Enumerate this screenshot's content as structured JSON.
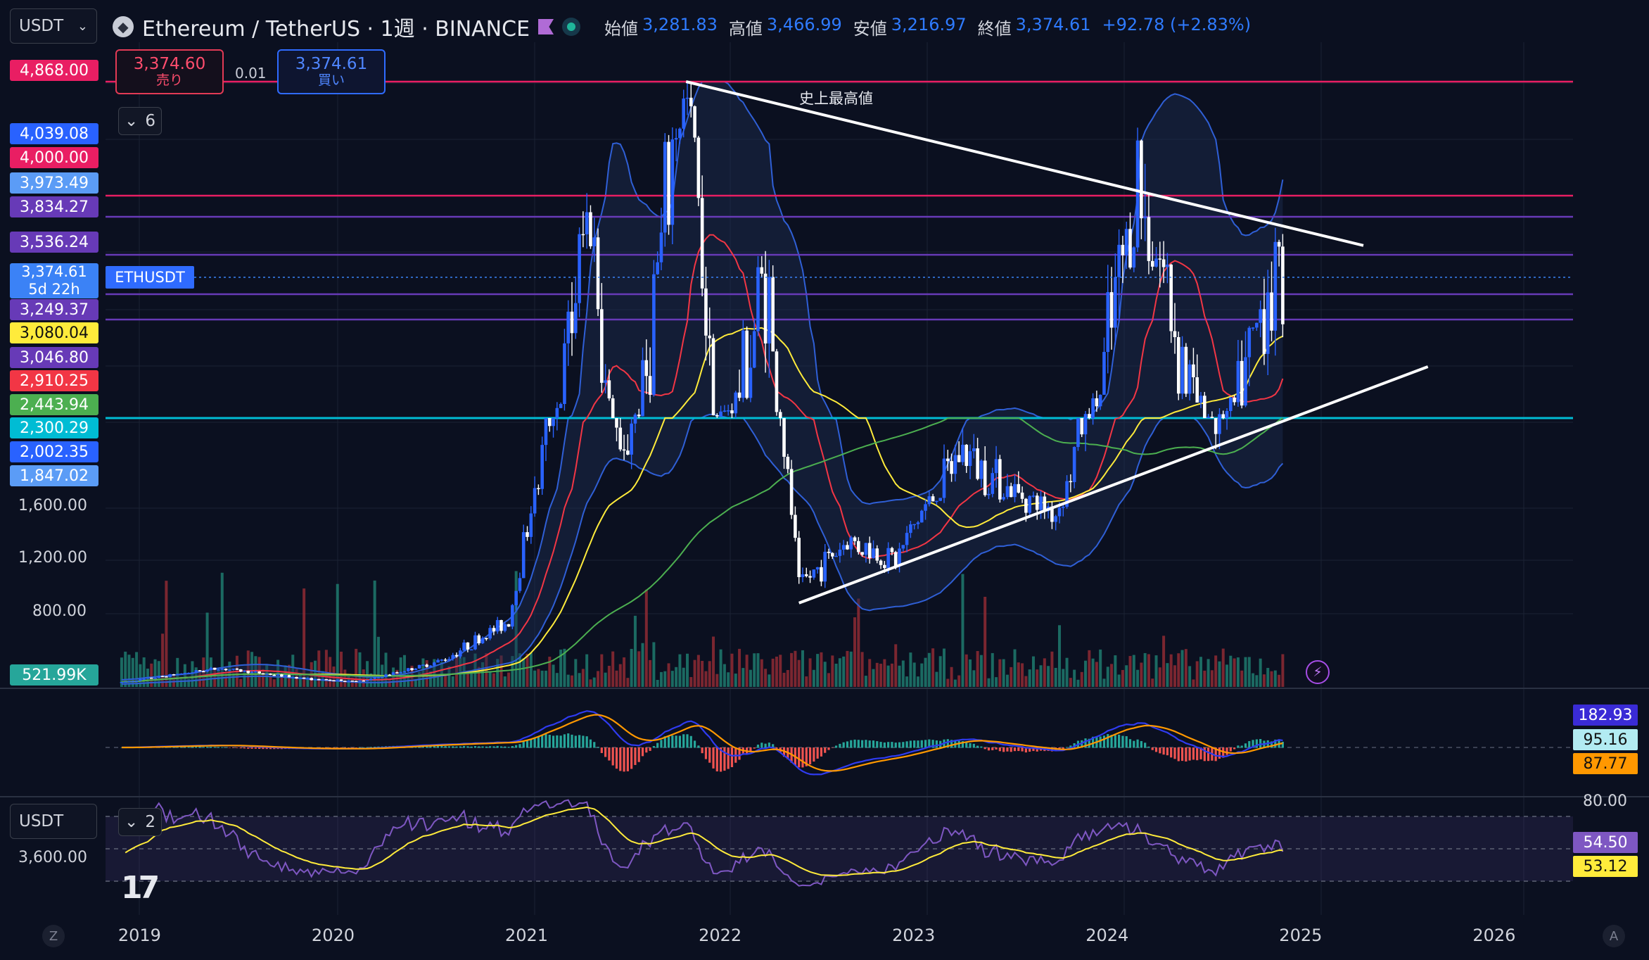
{
  "header": {
    "symbol_select": "USDT",
    "title": "Ethereum / TetherUS · 1週 · BINANCE",
    "ohlc": {
      "open_label": "始値",
      "open": "3,281.83",
      "high_label": "高値",
      "high": "3,466.99",
      "low_label": "安値",
      "low": "3,216.97",
      "close_label": "終値",
      "close": "3,374.61",
      "change": "+92.78 (+2.83%)"
    }
  },
  "trade": {
    "sell_price": "3,374.60",
    "sell_label": "売り",
    "spread": "0.01",
    "buy_price": "3,374.61",
    "buy_label": "買い"
  },
  "indicators_toggle": {
    "count": "6"
  },
  "symbol_tag": "ETHUSDT",
  "annotation": "史上最高値",
  "current_price": {
    "value": "3,374.61",
    "countdown": "5d 22h"
  },
  "price_tags": [
    {
      "value": "4,868.00",
      "color": "#e91e63"
    },
    {
      "value": "4,039.08",
      "color": "#2962ff"
    },
    {
      "value": "4,000.00",
      "color": "#e91e63"
    },
    {
      "value": "3,973.49",
      "color": "#5b9cf6"
    },
    {
      "value": "3,834.27",
      "color": "#673ab7"
    },
    {
      "value": "3,536.24",
      "color": "#673ab7"
    },
    {
      "value": "3,249.37",
      "color": "#673ab7"
    },
    {
      "value": "3,080.04",
      "color": "#ffeb3b"
    },
    {
      "value": "3,046.80",
      "color": "#673ab7"
    },
    {
      "value": "2,910.25",
      "color": "#f23645"
    },
    {
      "value": "2,443.94",
      "color": "#4caf50"
    },
    {
      "value": "2,300.29",
      "color": "#00bcd4"
    },
    {
      "value": "2,002.35",
      "color": "#2962ff"
    },
    {
      "value": "1,847.02",
      "color": "#5b9cf6"
    }
  ],
  "left_axis": [
    "1,600.00",
    "1,200.00",
    "800.00"
  ],
  "volume_tag": "521.99K",
  "macd_tags": [
    {
      "value": "182.93",
      "color": "#3a2bd6"
    },
    {
      "value": "95.16",
      "color": "#b2ebf2"
    },
    {
      "value": "87.77",
      "color": "#ff9800"
    }
  ],
  "rsi": {
    "symbol_select": "USDT",
    "toggle_count": "2",
    "left_value": "3,600.00",
    "levels": [
      "80.00"
    ],
    "tags": [
      {
        "value": "54.50",
        "color": "#7e57c2"
      },
      {
        "value": "53.12",
        "color": "#ffeb3b"
      }
    ]
  },
  "x_axis": [
    "2019",
    "2020",
    "2021",
    "2022",
    "2023",
    "2024",
    "2025",
    "2026"
  ],
  "bottom_icons": {
    "left": "Z",
    "right": "A"
  },
  "colors": {
    "background": "#0b1020",
    "up": "#2962ff",
    "down": "#ffffff",
    "bb": "#2f5fd6",
    "ma_red": "#f23645",
    "ma_yellow": "#ffeb3b",
    "ma_green": "#4caf50",
    "trend_line": "#ffffff",
    "h_pink": "#e91e63",
    "h_purple": "#673ab7",
    "h_cyan": "#00bcd4"
  },
  "chart_data": {
    "type": "candlestick",
    "symbol": "ETHUSDT",
    "interval": "1W",
    "x_range": [
      "2018-11",
      "2026-06"
    ],
    "y_axis_ticks": [
      800,
      1200,
      1600
    ],
    "weekly_close_path": [
      {
        "date": "2018-12",
        "close": 90
      },
      {
        "date": "2019-06",
        "close": 300
      },
      {
        "date": "2019-12",
        "close": 130
      },
      {
        "date": "2020-03",
        "close": 110
      },
      {
        "date": "2020-08",
        "close": 420
      },
      {
        "date": "2020-12",
        "close": 740
      },
      {
        "date": "2021-05",
        "close": 3900
      },
      {
        "date": "2021-07",
        "close": 1900
      },
      {
        "date": "2021-11",
        "close": 4650
      },
      {
        "date": "2022-01",
        "close": 2400
      },
      {
        "date": "2022-04",
        "close": 3450
      },
      {
        "date": "2022-06",
        "close": 1000
      },
      {
        "date": "2022-09",
        "close": 1350
      },
      {
        "date": "2022-12",
        "close": 1200
      },
      {
        "date": "2023-04",
        "close": 2100
      },
      {
        "date": "2023-10",
        "close": 1550
      },
      {
        "date": "2024-03",
        "close": 3950
      },
      {
        "date": "2024-08",
        "close": 2300
      },
      {
        "date": "2024-11",
        "close": 3400
      },
      {
        "date": "2024-12",
        "close": 3374.61
      }
    ],
    "horizontal_levels": [
      4868,
      4000,
      3834.27,
      3536.24,
      3249.37,
      2300.29
    ],
    "trend_lines": [
      {
        "name": "upper",
        "from": {
          "date": "2021-11",
          "price": 4868
        },
        "to": {
          "date": "2025-05",
          "price": 3600
        }
      },
      {
        "name": "lower",
        "from": {
          "date": "2022-06",
          "price": 880
        },
        "to": {
          "date": "2025-09",
          "price": 3000
        }
      }
    ]
  }
}
